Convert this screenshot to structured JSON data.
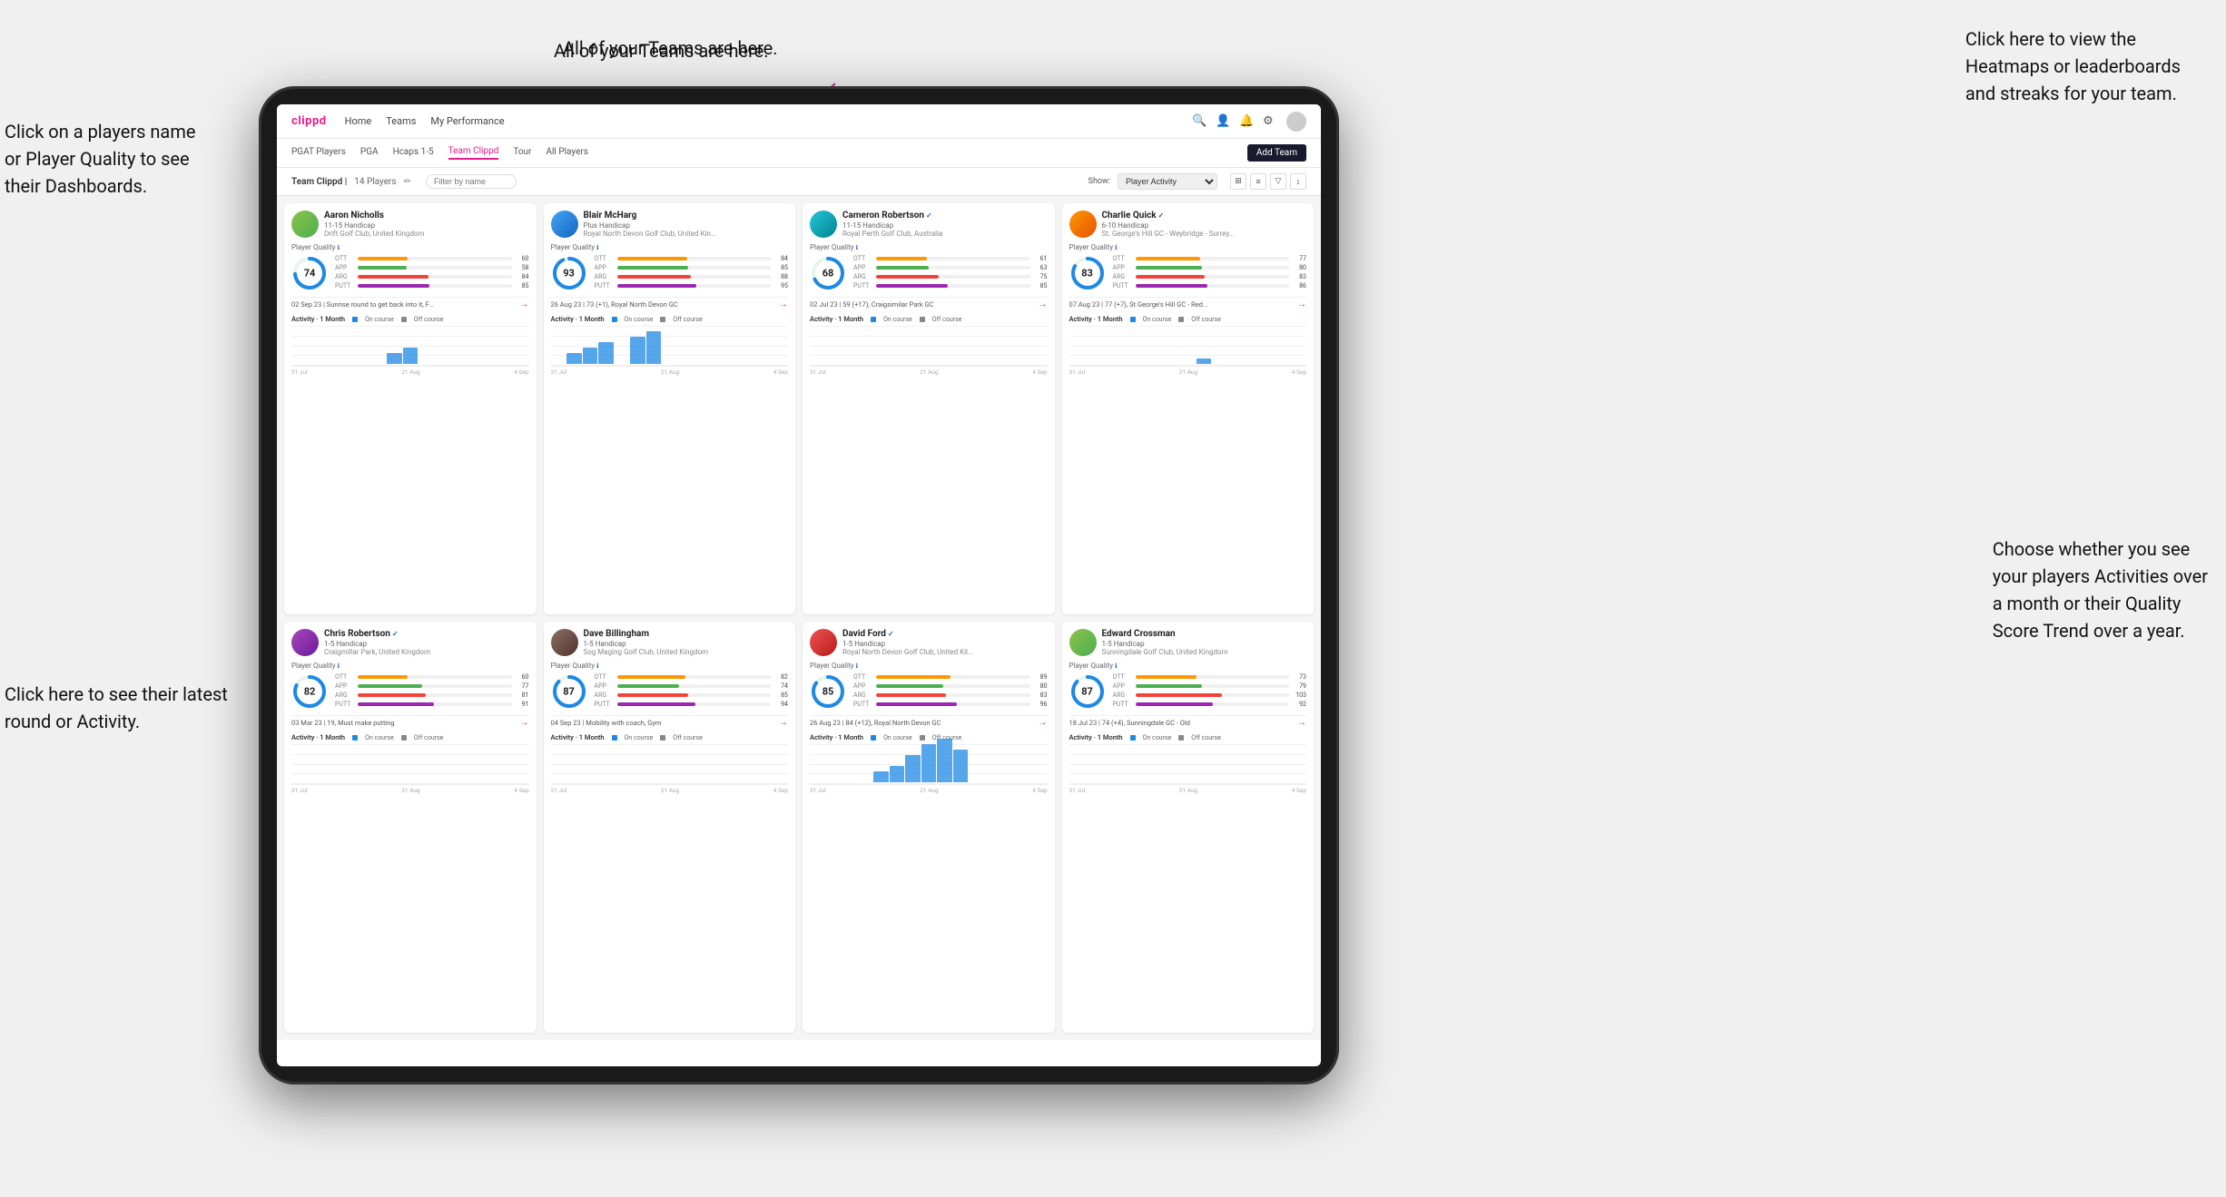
{
  "annotations": {
    "teams_annotation": "All of your Teams are here.",
    "heatmaps_annotation": "Click here to view the\nHeatmaps or leaderboards\nand streaks for your team.",
    "players_name_annotation": "Click on a players name\nor Player Quality to see\ntheir Dashboards.",
    "activities_annotation": "Choose whether you see\nyour players Activities over\na month or their Quality\nScore Trend over a year.",
    "latest_round_annotation": "Click here to see their latest\nround or Activity."
  },
  "nav": {
    "logo": "clippd",
    "links": [
      "Home",
      "Teams",
      "My Performance"
    ],
    "icons": [
      "search",
      "person",
      "bell",
      "settings",
      "avatar"
    ]
  },
  "sub_nav": {
    "items": [
      "PGAT Players",
      "PGA",
      "Hcaps 1-5",
      "Team Clippd",
      "Tour",
      "All Players"
    ],
    "active": "Team Clippd",
    "add_button": "Add Team"
  },
  "team_header": {
    "title": "Team Clippd",
    "count": "14 Players",
    "filter_placeholder": "Filter by name",
    "show_label": "Show:",
    "show_value": "Player Activity"
  },
  "players": [
    {
      "name": "Aaron Nicholls",
      "handicap": "11-15 Handicap",
      "club": "Drift Golf Club, United Kingdom",
      "score": 74,
      "score_color": "#1565C0",
      "ott": 60,
      "app": 58,
      "arg": 84,
      "putt": 85,
      "last_activity": "02 Sep 23 | Sunrise round to get back into it, F...",
      "avatar_color": "green",
      "chart_data": [
        0,
        0,
        0,
        0,
        0,
        0,
        2,
        3,
        0,
        0,
        0,
        0,
        0,
        0,
        0
      ]
    },
    {
      "name": "Blair McHarg",
      "handicap": "Plus Handicap",
      "club": "Royal North Devon Golf Club, United Kin...",
      "score": 93,
      "score_color": "#1565C0",
      "ott": 84,
      "app": 85,
      "arg": 88,
      "putt": 95,
      "last_activity": "26 Aug 23 | 73 (+1), Royal North Devon GC",
      "avatar_color": "blue",
      "chart_data": [
        0,
        2,
        3,
        4,
        0,
        5,
        6,
        0,
        0,
        0,
        0,
        0,
        0,
        0,
        0
      ]
    },
    {
      "name": "Cameron Robertson",
      "handicap": "11-15 Handicap",
      "club": "Royal Perth Golf Club, Australia",
      "score": 68,
      "score_color": "#1565C0",
      "ott": 61,
      "app": 63,
      "arg": 75,
      "putt": 85,
      "last_activity": "02 Jul 23 | 59 (+17), Craigsimilar Park GC",
      "avatar_color": "teal",
      "chart_data": [
        0,
        0,
        0,
        0,
        0,
        0,
        0,
        0,
        0,
        0,
        0,
        0,
        0,
        0,
        0
      ],
      "verified": true
    },
    {
      "name": "Charlie Quick",
      "handicap": "6-10 Handicap",
      "club": "St. George's Hill GC - Weybridge - Surrey...",
      "score": 83,
      "score_color": "#1565C0",
      "ott": 77,
      "app": 80,
      "arg": 83,
      "putt": 86,
      "last_activity": "07 Aug 23 | 77 (+7), St George's Hill GC - Red...",
      "avatar_color": "orange",
      "chart_data": [
        0,
        0,
        0,
        0,
        0,
        0,
        0,
        0,
        1,
        0,
        0,
        0,
        0,
        0,
        0
      ],
      "verified": true
    },
    {
      "name": "Chris Robertson",
      "handicap": "1-5 Handicap",
      "club": "Craigmillar Park, United Kingdom",
      "score": 82,
      "score_color": "#1565C0",
      "ott": 60,
      "app": 77,
      "arg": 81,
      "putt": 91,
      "last_activity": "03 Mar 23 | 19, Must make putting",
      "avatar_color": "purple",
      "chart_data": [
        0,
        0,
        0,
        0,
        0,
        0,
        0,
        0,
        0,
        0,
        0,
        0,
        0,
        0,
        0
      ],
      "verified": true
    },
    {
      "name": "Dave Billingham",
      "handicap": "1-5 Handicap",
      "club": "Sog Maging Golf Club, United Kingdom",
      "score": 87,
      "score_color": "#1565C0",
      "ott": 82,
      "app": 74,
      "arg": 85,
      "putt": 94,
      "last_activity": "04 Sep 23 | Mobility with coach, Gym",
      "avatar_color": "brown",
      "chart_data": [
        0,
        0,
        0,
        0,
        0,
        0,
        0,
        0,
        0,
        0,
        0,
        0,
        0,
        0,
        0
      ]
    },
    {
      "name": "David Ford",
      "handicap": "1-5 Handicap",
      "club": "Royal North Devon Golf Club, United Kil...",
      "score": 85,
      "score_color": "#1565C0",
      "ott": 89,
      "app": 80,
      "arg": 83,
      "putt": 96,
      "last_activity": "26 Aug 23 | 84 (+12), Royal North Devon GC",
      "avatar_color": "red",
      "chart_data": [
        0,
        0,
        0,
        0,
        2,
        3,
        5,
        7,
        8,
        6,
        0,
        0,
        0,
        0,
        0
      ],
      "verified": true
    },
    {
      "name": "Edward Crossman",
      "handicap": "1-5 Handicap",
      "club": "Sunningdale Golf Club, United Kingdom",
      "score": 87,
      "score_color": "#1565C0",
      "ott": 73,
      "app": 79,
      "arg": 103,
      "putt": 92,
      "last_activity": "18 Jul 23 | 74 (+4), Sunningdale GC - Old",
      "avatar_color": "green",
      "chart_data": [
        0,
        0,
        0,
        0,
        0,
        0,
        0,
        0,
        0,
        0,
        0,
        0,
        0,
        0,
        0
      ]
    }
  ],
  "chart": {
    "x_labels": [
      "31 Jul",
      "21 Aug",
      "4 Sep"
    ],
    "legend": {
      "title": "Activity · 1 Month",
      "on_course": "On course",
      "off_course": "Off course"
    }
  }
}
